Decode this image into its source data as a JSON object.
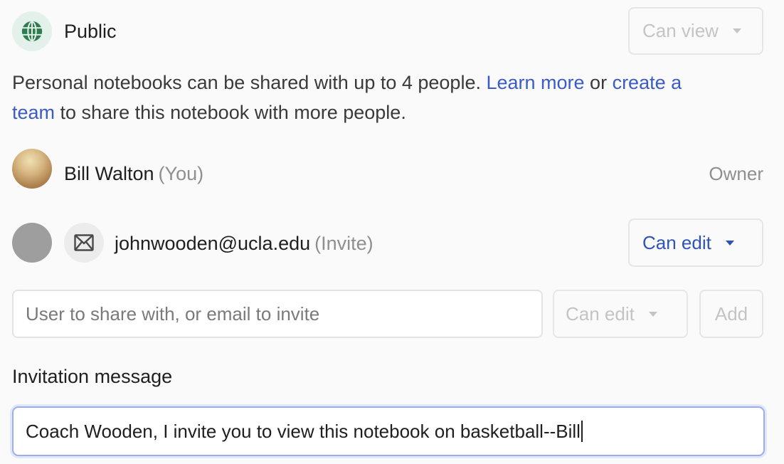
{
  "public": {
    "label": "Public",
    "icon": "globe-icon",
    "permission": "Can view"
  },
  "info": {
    "text_before": "Personal notebooks can be shared with up to 4 people. ",
    "learn_more": "Learn more",
    "text_or": " or ",
    "create_team_line1": "create a",
    "create_team_line2": "team",
    "text_after": " to share this notebook with more people.",
    "link_color": "#3b5cc4"
  },
  "owner": {
    "name": "Bill Walton",
    "you_tag": "(You)",
    "role": "Owner"
  },
  "invitee": {
    "email": "johnwooden@ucla.edu",
    "tag": "(Invite)",
    "icon": "mail-icon",
    "permission": "Can edit",
    "permission_color": "#2f54b8"
  },
  "share": {
    "placeholder": "User to share with, or email to invite",
    "permission": "Can edit",
    "add_label": "Add"
  },
  "message": {
    "label": "Invitation message",
    "value": "Coach Wooden, I invite you to view this notebook on basketball--Bill"
  }
}
